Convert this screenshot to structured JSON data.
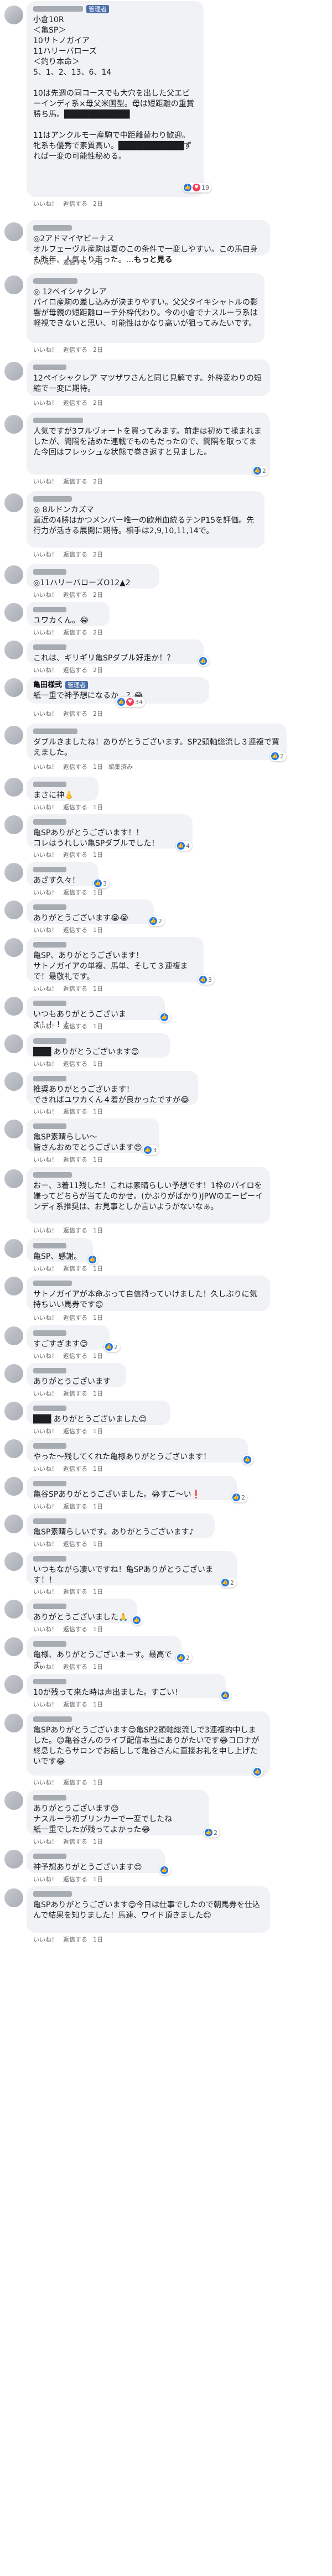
{
  "actions": {
    "like": "いいね！",
    "reply": "返信する",
    "edit": "編集済み"
  },
  "comments": [
    {
      "admin": true,
      "text": "小倉10R\n＜亀SP＞\n10サトノガイア\n11ハリーバローズ\n＜釣り本命＞\n5、1、2、13、6、14\n\n10は先週の同コースでも大穴を出した父エピーインディ系×母父米国型。母は短距離の重賞勝ち馬。███████████\n\n11はアンクルモー産駒で中距離替わり歓迎。牝系も優秀で素質高い。███████████ずれば一変の可能性秘める。",
      "time": "2日",
      "reactions": "19",
      "emo": "heart"
    },
    {
      "text": "◎2アドマイヤビーナス\nオルフェーヴル産駒は夏のこの条件で一変しやすい。この馬自身も昨年、人気より走った。…",
      "more": "もっと見る",
      "time": "2日"
    },
    {
      "text": "◎ 12ペイシャクレア\nパイロ産駒の差し込みが決まりやすい。父父タイキシャトルの影響が母親の短距離ローテ外枠代わり。今の小倉でナスルーラ系は軽視できないと思い、可能性はかなり高いが狙ってみたいです。",
      "time": "2日"
    },
    {
      "text": "12ペイシャクレア マツザワさんと同じ見解です。外枠変わりの短縮で一変に期待。",
      "time": "2日"
    },
    {
      "text": "人気ですが3フルヴォートを買ってみます。前走は初めて揉まれましたが、間隔を詰めた連戦でものもだったので、間隔を取ってまた今回はフレッシュな状態で巻き返すと見ました。",
      "time": "2日",
      "reactions": "2",
      "emo": "like"
    },
    {
      "text": "◎ 8ルドンカズマ\n直近の4勝はかつメンバー唯一の欧州血統るテンP15を評価。先行力が活きる展開に期待。相手は2,9,10,11,14で。",
      "time": "2日"
    },
    {
      "text": "◎11ハリーバローズO12▲2",
      "time": "2日"
    },
    {
      "text": "ユワカくん。😂",
      "time": "2日"
    },
    {
      "text": "これは、ギリギリ亀SPダブル好走か！？",
      "time": "2日",
      "reactions": "",
      "emo": "like"
    },
    {
      "author": "亀田様弐",
      "admin": true,
      "text": "紙一重で神予想になるか…？😂",
      "time": "2日",
      "reactions": "34",
      "emo": "like"
    },
    {
      "text": "ダブルきましたね！ありがとうございます。SP2頭軸総流し３連複で買えました。",
      "time": "1日",
      "reactions": "2",
      "emo": "like",
      "edited": true
    },
    {
      "text": "まさに神👃",
      "time": "1日"
    },
    {
      "text": "亀SPありがとうございます！！\nコレはうれしい亀SPダブルでした！",
      "time": "1日",
      "reactions": "4",
      "emo": "like"
    },
    {
      "text": "あざす久々！",
      "time": "1日",
      "reactions": "3",
      "emo": "like"
    },
    {
      "text": "ありがとうございます😭😭",
      "time": "1日",
      "reactions": "2",
      "emo": "like"
    },
    {
      "text": "亀SP、ありがとうございます！\nサトノガイアの単複、馬単、そして３連複まで！最敬礼です。",
      "time": "1日",
      "reactions": "3",
      "emo": "like"
    },
    {
      "text": "いつもありがとうございます！！！！",
      "time": "1日",
      "reactions": "",
      "emo": "like"
    },
    {
      "text": "███ ありがとうございます😊",
      "time": "1日"
    },
    {
      "text": "推奨ありがとうございます！\nできればユワカくん４着が良かったですが😂",
      "time": "1日"
    },
    {
      "text": "亀SP素晴らしい～\n皆さんおめでとうございます😍",
      "time": "1日",
      "reactions": "3",
      "emo": "like"
    },
    {
      "text": "おー、3着11残した！これは素晴らしい予想です！1枠のパイロを嫌ってどちらが当てたのかせ。(かぶりがばかり)JPWのエーピーインディ系推奨は、お見事としか言いようがないなぁ。",
      "time": "1日"
    },
    {
      "text": "亀SP、感謝。",
      "time": "1日",
      "reactions": "",
      "emo": "like"
    },
    {
      "text": "サトノガイアが本命ぶって自信持っていけました！久しぶりに気持ちいい馬券です😊",
      "time": "1日"
    },
    {
      "text": "すごすぎます😊",
      "time": "1日",
      "reactions": "2",
      "emo": "like"
    },
    {
      "text": "ありがとうございます",
      "time": "1日"
    },
    {
      "text": "███ ありがとうございました😊",
      "time": "1日"
    },
    {
      "text": "やった～残してくれた亀様ありがとうございます！",
      "time": "1日",
      "reactions": "",
      "emo": "like"
    },
    {
      "text": "亀谷SPありがとうございました。😂すご～い❗",
      "time": "1日",
      "reactions": "2",
      "emo": "like"
    },
    {
      "text": "亀SP素晴らしいです。ありがとうございます♪",
      "time": "1日"
    },
    {
      "text": "いつもながら凄いですね！亀SPありがとうございます！！",
      "time": "1日",
      "reactions": "2",
      "emo": "like"
    },
    {
      "text": "ありがとうございました🙏",
      "time": "1日",
      "reactions": "",
      "emo": "like"
    },
    {
      "text": "亀様、ありがとうございまーす。最高です。",
      "time": "1日",
      "reactions": "2",
      "emo": "like"
    },
    {
      "text": "10が残って来た時は声出ました。すごい！",
      "time": "1日",
      "reactions": "",
      "emo": "like"
    },
    {
      "text": "亀SPありがとうございます😊亀SP2頭軸総流しで3連複的中しました。😊亀谷さんのライブ配信本当にありがたいです😂コロナが終息したらサロンでお話しして亀谷さんに直接お礼を申し上げたいです😂",
      "time": "1日",
      "reactions": "",
      "emo": "like"
    },
    {
      "text": "ありがとうございます😊\nナスルーラ初ブリンカーで一変でしたね\n紙一重でしたが残ってよかった😂",
      "time": "1日",
      "reactions": "2",
      "emo": "like"
    },
    {
      "text": "神予想ありがとうございます😊",
      "time": "1日",
      "reactions": "",
      "emo": "like"
    },
    {
      "text": "亀SPありがとうございます😊今日は仕事でしたので朝馬券を仕込んで結果を知りました！馬連、ワイド頂きました😊",
      "time": "1日"
    }
  ]
}
